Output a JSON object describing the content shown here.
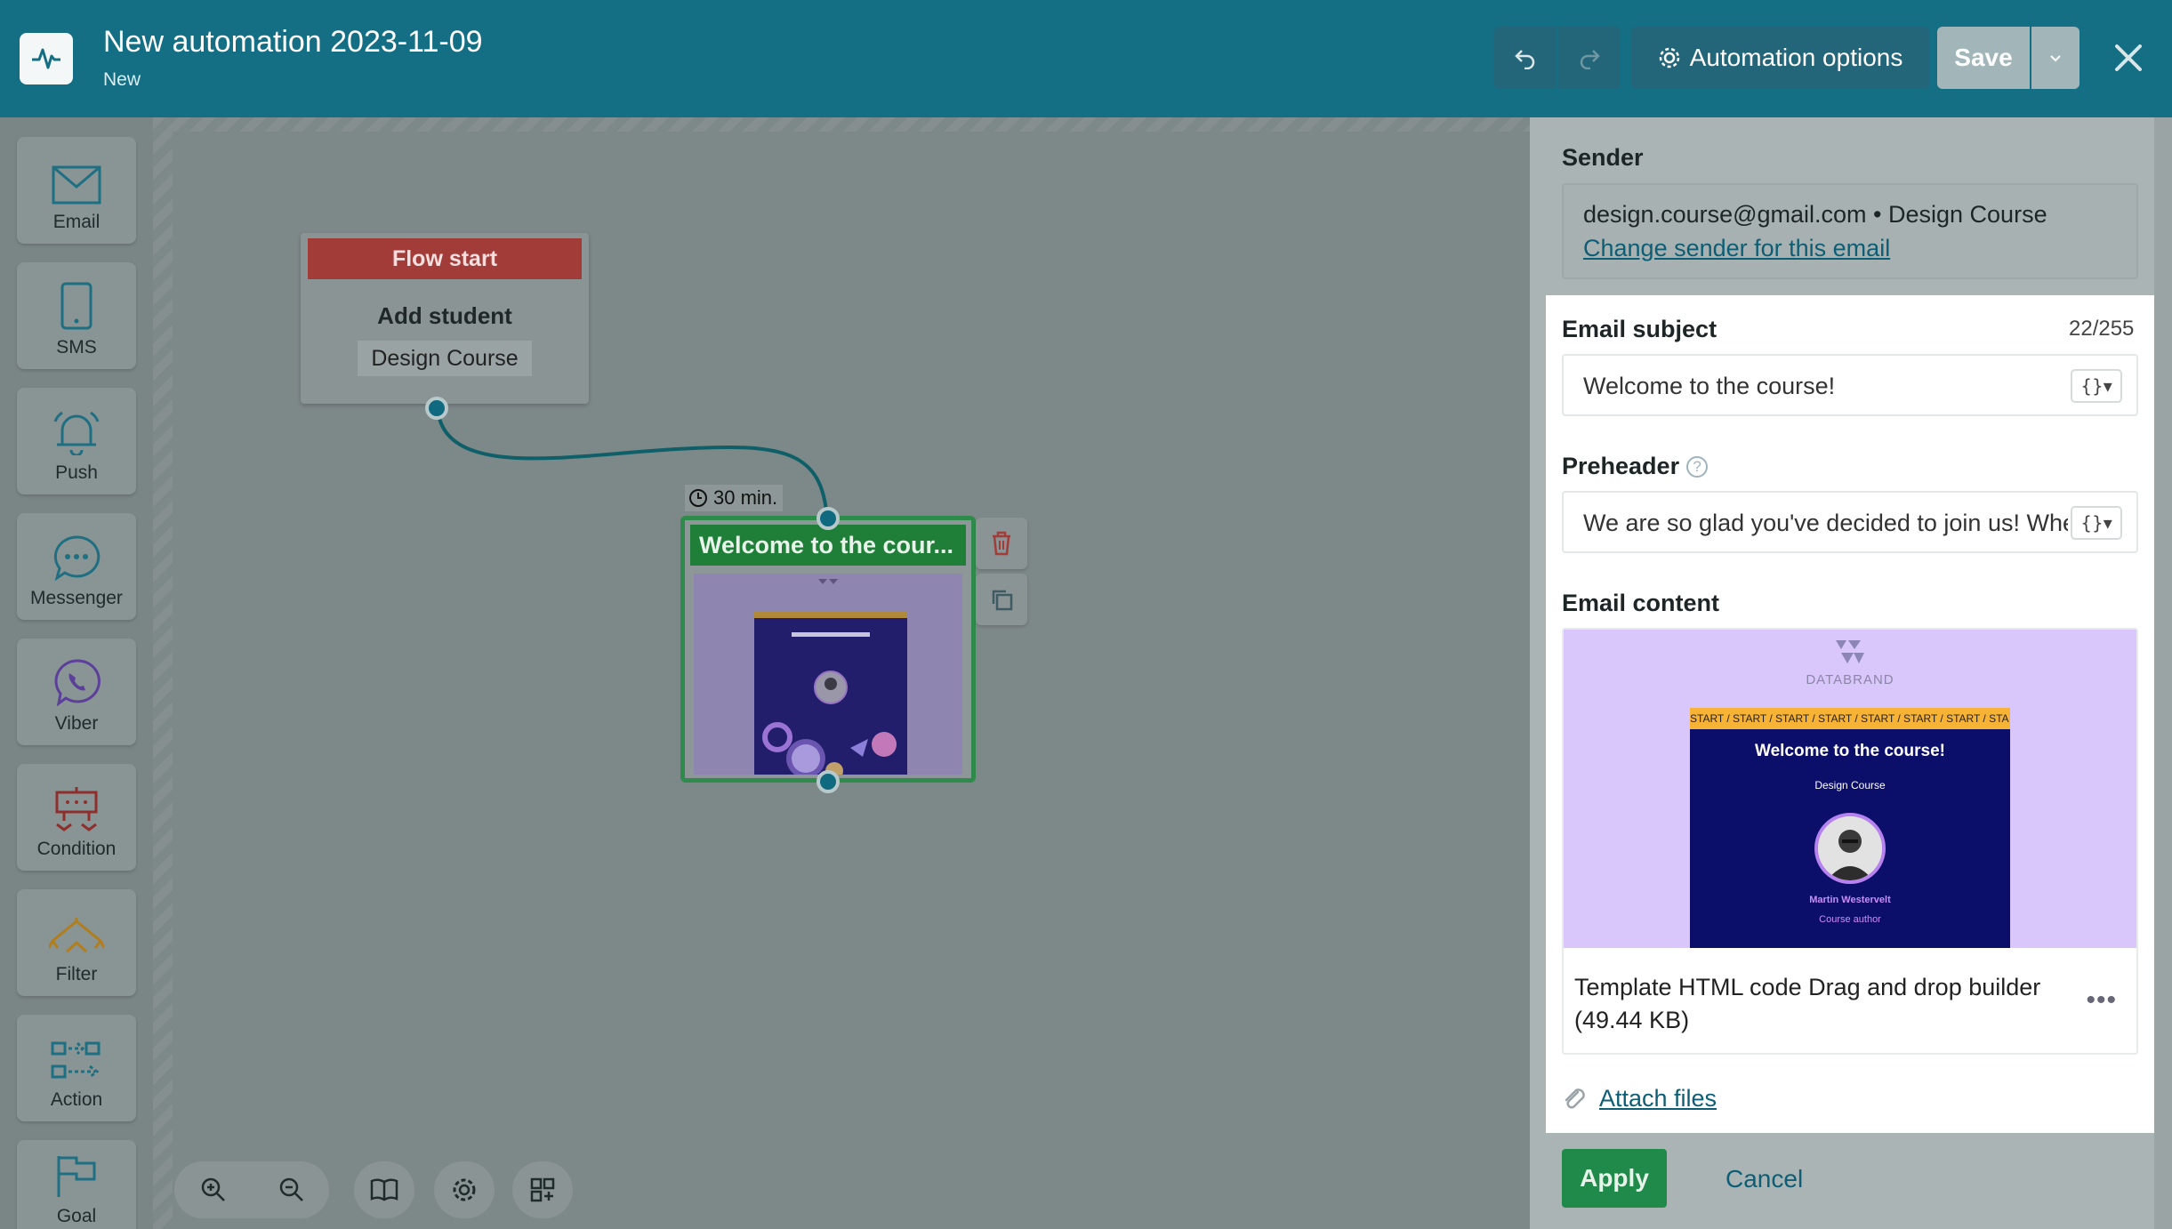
{
  "header": {
    "title": "New automation 2023-11-09",
    "status": "New",
    "automation_options_label": "Automation options",
    "save_label": "Save"
  },
  "palette": {
    "items": [
      {
        "label": "Email",
        "icon": "envelope-icon"
      },
      {
        "label": "SMS",
        "icon": "phone-icon"
      },
      {
        "label": "Push",
        "icon": "bell-icon"
      },
      {
        "label": "Messenger",
        "icon": "chat-icon"
      },
      {
        "label": "Viber",
        "icon": "viber-icon"
      },
      {
        "label": "Condition",
        "icon": "condition-icon"
      },
      {
        "label": "Filter",
        "icon": "filter-icon"
      },
      {
        "label": "Action",
        "icon": "action-icon"
      },
      {
        "label": "Goal",
        "icon": "flag-icon"
      }
    ]
  },
  "canvas": {
    "flow_start": {
      "header": "Flow start",
      "title": "Add student",
      "tag": "Design Course"
    },
    "delay_label": "30 min.",
    "email_node": {
      "title": "Welcome to the cour..."
    }
  },
  "panel": {
    "sender_label": "Sender",
    "sender_value": "design.course@gmail.com • Design Course",
    "change_sender_link": "Change sender for this email",
    "subject_label": "Email subject",
    "subject_counter": "22/255",
    "subject_value": "Welcome to the course!",
    "preheader_label": "Preheader",
    "preheader_value": "We are so glad you've decided to join us! Whe",
    "content_label": "Email content",
    "preview": {
      "brand": "DATABRAND",
      "start_strip": "START / START / START / START / START / START / START / STA",
      "title": "Welcome to the course!",
      "course": "Design Course",
      "author_name": "Martin Westervelt",
      "author_role": "Course author"
    },
    "template_info": "Template HTML code Drag and drop builder (49.44 KB)",
    "attach_label": "Attach files",
    "apply_label": "Apply",
    "cancel_label": "Cancel"
  },
  "colors": {
    "topbar": "#156f84",
    "flow_start": "#a13c39",
    "email_node": "#1f7e37",
    "apply": "#208a4a",
    "link": "#0d5e74"
  }
}
